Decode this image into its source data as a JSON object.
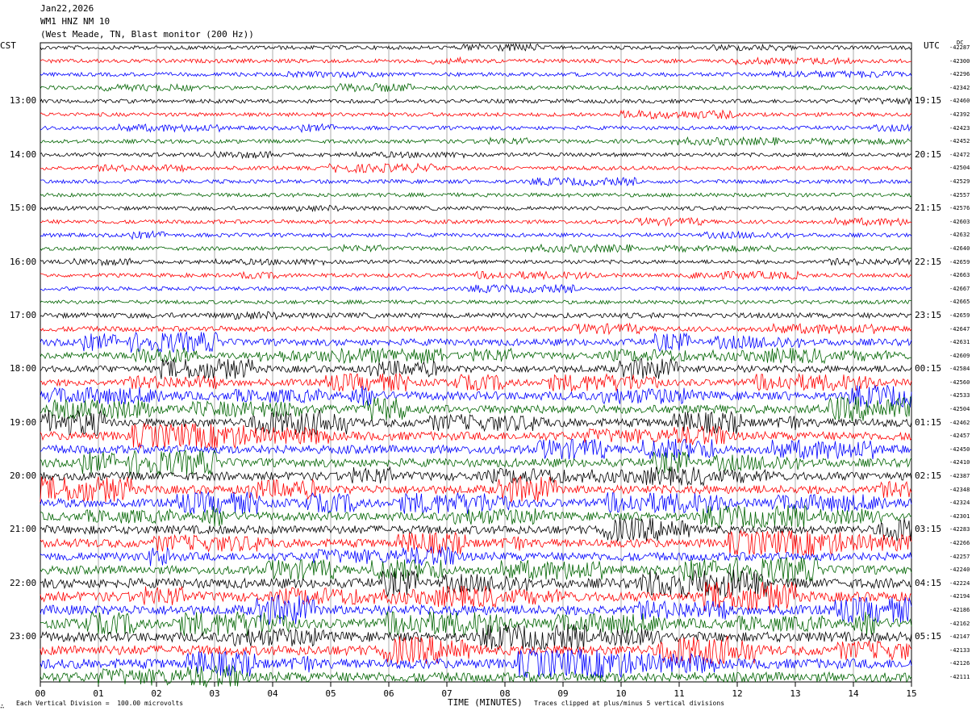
{
  "header": {
    "date": "Jan22,2026",
    "station": "WM1 HNZ NM 10",
    "location": "(West Meade, TN, Blast monitor (200 Hz))"
  },
  "left_label": "CST",
  "right_label": "UTC",
  "dc_label": "DC",
  "footer": {
    "scale_note": "Each Vertical Division =  100.00 microvolts",
    "clip_note": "Traces clipped at plus/minus 5 vertical divisions",
    "corner_mark": "∴"
  },
  "chart_data": {
    "type": "line",
    "title": "",
    "xlabel": "TIME (MINUTES)",
    "xlim": [
      0,
      15
    ],
    "x_ticks": [
      "00",
      "01",
      "02",
      "03",
      "04",
      "05",
      "06",
      "07",
      "08",
      "09",
      "10",
      "11",
      "12",
      "13",
      "14",
      "15"
    ],
    "grid": true,
    "trace_colors": [
      "#000000",
      "#ff0000",
      "#0000ff",
      "#006400"
    ],
    "cst_hour_labels": [
      "13:00",
      "14:00",
      "15:00",
      "16:00",
      "17:00",
      "18:00",
      "19:00",
      "20:00",
      "21:00",
      "22:00",
      "23:00"
    ],
    "utc_hour_labels": [
      "19:15",
      "20:15",
      "21:15",
      "22:15",
      "23:15",
      "00:15",
      "01:15",
      "02:15",
      "03:15",
      "04:15",
      "05:15"
    ],
    "dc_offsets": [
      "-42287",
      "-42300",
      "-42296",
      "-42342",
      "-42460",
      "-42392",
      "-42423",
      "-42452",
      "-42472",
      "-42504",
      "-42529",
      "-42557",
      "-42576",
      "-42603",
      "-42632",
      "-42640",
      "-42659",
      "-42663",
      "-42667",
      "-42665",
      "-42659",
      "-42647",
      "-42631",
      "-42609",
      "-42584",
      "-42560",
      "-42533",
      "-42504",
      "-42462",
      "-42457",
      "-42450",
      "-42410",
      "-42387",
      "-42348",
      "-42324",
      "-42301",
      "-42283",
      "-42266",
      "-42257",
      "-42240",
      "-42224",
      "-42194",
      "-42186",
      "-42162",
      "-42147",
      "-42133",
      "-42126",
      "-42111"
    ],
    "trace_amplitude_levels": [
      1,
      1,
      1,
      1,
      1,
      1,
      1,
      1,
      1,
      1,
      1,
      1,
      1,
      1,
      1,
      1,
      1,
      1,
      1,
      1,
      2,
      2,
      3,
      3,
      3,
      3,
      4,
      4,
      4,
      4,
      4,
      4,
      4,
      4,
      4,
      4,
      4,
      4,
      4,
      4,
      5,
      5,
      5,
      5,
      5,
      5,
      5,
      5
    ]
  }
}
